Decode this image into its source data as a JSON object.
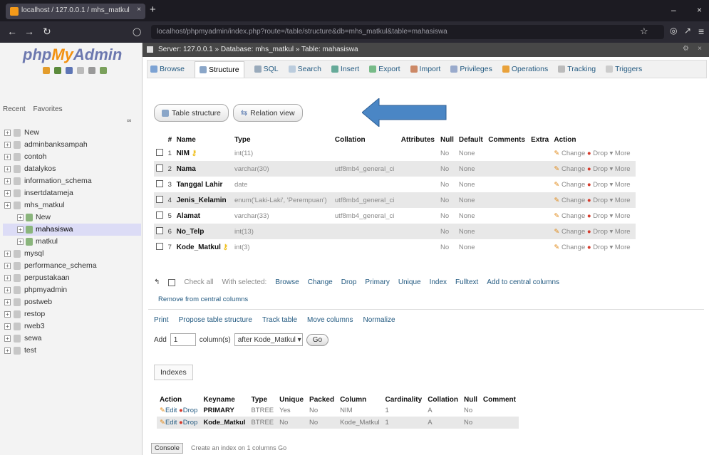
{
  "browser": {
    "tab_title": "localhost / 127.0.0.1 / mhs_matkul",
    "url": "localhost/phpmyadmin/index.php?route=/table/structure&db=mhs_matkul&table=mahasiswa"
  },
  "sidebar": {
    "logo": {
      "php": "php",
      "my": "My",
      "admin": "Admin"
    },
    "recent": "Recent",
    "favorites": "Favorites",
    "databases": [
      {
        "label": "New",
        "sub": false
      },
      {
        "label": "adminbanksampah",
        "sub": false
      },
      {
        "label": "contoh",
        "sub": false
      },
      {
        "label": "datalykos",
        "sub": false
      },
      {
        "label": "information_schema",
        "sub": false
      },
      {
        "label": "insertdatameja",
        "sub": false
      },
      {
        "label": "mhs_matkul",
        "sub": false
      },
      {
        "label": "New",
        "sub": true
      },
      {
        "label": "mahasiswa",
        "sub": true
      },
      {
        "label": "matkul",
        "sub": true
      },
      {
        "label": "mysql",
        "sub": false
      },
      {
        "label": "performance_schema",
        "sub": false
      },
      {
        "label": "perpustakaan",
        "sub": false
      },
      {
        "label": "phpmyadmin",
        "sub": false
      },
      {
        "label": "postweb",
        "sub": false
      },
      {
        "label": "restop",
        "sub": false
      },
      {
        "label": "rweb3",
        "sub": false
      },
      {
        "label": "sewa",
        "sub": false
      },
      {
        "label": "test",
        "sub": false
      }
    ]
  },
  "breadcrumb": "Server: 127.0.0.1 » Database: mhs_matkul » Table: mahasiswa",
  "tabs": [
    "Browse",
    "Structure",
    "SQL",
    "Search",
    "Insert",
    "Export",
    "Import",
    "Privileges",
    "Operations",
    "Tracking",
    "Triggers"
  ],
  "subtabs": [
    "Table structure",
    "Relation view"
  ],
  "structure": {
    "headers": [
      "#",
      "Name",
      "Type",
      "Collation",
      "Attributes",
      "Null",
      "Default",
      "Comments",
      "Extra",
      "Action"
    ],
    "rows": [
      {
        "n": "1",
        "name": "NIM",
        "key": true,
        "type": "int(11)",
        "collation": "",
        "null": "No",
        "default": "None"
      },
      {
        "n": "2",
        "name": "Nama",
        "key": false,
        "type": "varchar(30)",
        "collation": "utf8mb4_general_ci",
        "null": "No",
        "default": "None"
      },
      {
        "n": "3",
        "name": "Tanggal Lahir",
        "key": false,
        "type": "date",
        "collation": "",
        "null": "No",
        "default": "None"
      },
      {
        "n": "4",
        "name": "Jenis_Kelamin",
        "key": false,
        "type": "enum('Laki-Laki', 'Perempuan')",
        "collation": "utf8mb4_general_ci",
        "null": "No",
        "default": "None"
      },
      {
        "n": "5",
        "name": "Alamat",
        "key": false,
        "type": "varchar(33)",
        "collation": "utf8mb4_general_ci",
        "null": "No",
        "default": "None"
      },
      {
        "n": "6",
        "name": "No_Telp",
        "key": false,
        "type": "int(13)",
        "collation": "",
        "null": "No",
        "default": "None"
      },
      {
        "n": "7",
        "name": "Kode_Matkul",
        "key": true,
        "type": "int(3)",
        "collation": "",
        "null": "No",
        "default": "None"
      }
    ],
    "actions": {
      "change": "Change",
      "drop": "Drop",
      "more": "More"
    }
  },
  "bulk": {
    "check_all": "Check all",
    "with_selected": "With selected:",
    "browse": "Browse",
    "change": "Change",
    "drop": "Drop",
    "primary": "Primary",
    "unique": "Unique",
    "index": "Index",
    "fulltext": "Fulltext",
    "add_central": "Add to central columns",
    "remove_central": "Remove from central columns"
  },
  "tools": {
    "print": "Print",
    "propose": "Propose table structure",
    "track": "Track table",
    "move": "Move columns",
    "normalize": "Normalize",
    "add_label": "Add",
    "add_value": "1",
    "columns_label": "column(s)",
    "after_select": "after Kode_Matkul",
    "go": "Go"
  },
  "indexes": {
    "title": "Indexes",
    "headers": [
      "Action",
      "Keyname",
      "Type",
      "Unique",
      "Packed",
      "Column",
      "Cardinality",
      "Collation",
      "Null",
      "Comment"
    ],
    "rows": [
      {
        "edit": "Edit",
        "drop": "Drop",
        "keyname": "PRIMARY",
        "type": "BTREE",
        "unique": "Yes",
        "packed": "No",
        "column": "NIM",
        "cardinality": "1",
        "collation": "A",
        "null": "No"
      },
      {
        "edit": "Edit",
        "drop": "Drop",
        "keyname": "Kode_Matkul",
        "type": "BTREE",
        "unique": "No",
        "packed": "No",
        "column": "Kode_Matkul",
        "cardinality": "1",
        "collation": "A",
        "null": "No"
      }
    ]
  },
  "console": "Console",
  "bottom": "Create an index on  1  columns  Go"
}
